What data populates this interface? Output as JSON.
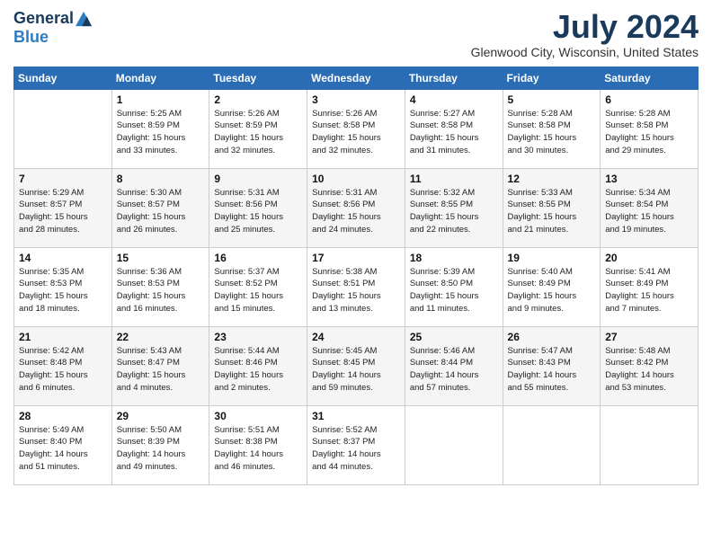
{
  "logo": {
    "text_general": "General",
    "text_blue": "Blue"
  },
  "title": "July 2024",
  "location": "Glenwood City, Wisconsin, United States",
  "days_of_week": [
    "Sunday",
    "Monday",
    "Tuesday",
    "Wednesday",
    "Thursday",
    "Friday",
    "Saturday"
  ],
  "weeks": [
    [
      {
        "day": "",
        "info": ""
      },
      {
        "day": "1",
        "info": "Sunrise: 5:25 AM\nSunset: 8:59 PM\nDaylight: 15 hours\nand 33 minutes."
      },
      {
        "day": "2",
        "info": "Sunrise: 5:26 AM\nSunset: 8:59 PM\nDaylight: 15 hours\nand 32 minutes."
      },
      {
        "day": "3",
        "info": "Sunrise: 5:26 AM\nSunset: 8:58 PM\nDaylight: 15 hours\nand 32 minutes."
      },
      {
        "day": "4",
        "info": "Sunrise: 5:27 AM\nSunset: 8:58 PM\nDaylight: 15 hours\nand 31 minutes."
      },
      {
        "day": "5",
        "info": "Sunrise: 5:28 AM\nSunset: 8:58 PM\nDaylight: 15 hours\nand 30 minutes."
      },
      {
        "day": "6",
        "info": "Sunrise: 5:28 AM\nSunset: 8:58 PM\nDaylight: 15 hours\nand 29 minutes."
      }
    ],
    [
      {
        "day": "7",
        "info": "Sunrise: 5:29 AM\nSunset: 8:57 PM\nDaylight: 15 hours\nand 28 minutes."
      },
      {
        "day": "8",
        "info": "Sunrise: 5:30 AM\nSunset: 8:57 PM\nDaylight: 15 hours\nand 26 minutes."
      },
      {
        "day": "9",
        "info": "Sunrise: 5:31 AM\nSunset: 8:56 PM\nDaylight: 15 hours\nand 25 minutes."
      },
      {
        "day": "10",
        "info": "Sunrise: 5:31 AM\nSunset: 8:56 PM\nDaylight: 15 hours\nand 24 minutes."
      },
      {
        "day": "11",
        "info": "Sunrise: 5:32 AM\nSunset: 8:55 PM\nDaylight: 15 hours\nand 22 minutes."
      },
      {
        "day": "12",
        "info": "Sunrise: 5:33 AM\nSunset: 8:55 PM\nDaylight: 15 hours\nand 21 minutes."
      },
      {
        "day": "13",
        "info": "Sunrise: 5:34 AM\nSunset: 8:54 PM\nDaylight: 15 hours\nand 19 minutes."
      }
    ],
    [
      {
        "day": "14",
        "info": "Sunrise: 5:35 AM\nSunset: 8:53 PM\nDaylight: 15 hours\nand 18 minutes."
      },
      {
        "day": "15",
        "info": "Sunrise: 5:36 AM\nSunset: 8:53 PM\nDaylight: 15 hours\nand 16 minutes."
      },
      {
        "day": "16",
        "info": "Sunrise: 5:37 AM\nSunset: 8:52 PM\nDaylight: 15 hours\nand 15 minutes."
      },
      {
        "day": "17",
        "info": "Sunrise: 5:38 AM\nSunset: 8:51 PM\nDaylight: 15 hours\nand 13 minutes."
      },
      {
        "day": "18",
        "info": "Sunrise: 5:39 AM\nSunset: 8:50 PM\nDaylight: 15 hours\nand 11 minutes."
      },
      {
        "day": "19",
        "info": "Sunrise: 5:40 AM\nSunset: 8:49 PM\nDaylight: 15 hours\nand 9 minutes."
      },
      {
        "day": "20",
        "info": "Sunrise: 5:41 AM\nSunset: 8:49 PM\nDaylight: 15 hours\nand 7 minutes."
      }
    ],
    [
      {
        "day": "21",
        "info": "Sunrise: 5:42 AM\nSunset: 8:48 PM\nDaylight: 15 hours\nand 6 minutes."
      },
      {
        "day": "22",
        "info": "Sunrise: 5:43 AM\nSunset: 8:47 PM\nDaylight: 15 hours\nand 4 minutes."
      },
      {
        "day": "23",
        "info": "Sunrise: 5:44 AM\nSunset: 8:46 PM\nDaylight: 15 hours\nand 2 minutes."
      },
      {
        "day": "24",
        "info": "Sunrise: 5:45 AM\nSunset: 8:45 PM\nDaylight: 14 hours\nand 59 minutes."
      },
      {
        "day": "25",
        "info": "Sunrise: 5:46 AM\nSunset: 8:44 PM\nDaylight: 14 hours\nand 57 minutes."
      },
      {
        "day": "26",
        "info": "Sunrise: 5:47 AM\nSunset: 8:43 PM\nDaylight: 14 hours\nand 55 minutes."
      },
      {
        "day": "27",
        "info": "Sunrise: 5:48 AM\nSunset: 8:42 PM\nDaylight: 14 hours\nand 53 minutes."
      }
    ],
    [
      {
        "day": "28",
        "info": "Sunrise: 5:49 AM\nSunset: 8:40 PM\nDaylight: 14 hours\nand 51 minutes."
      },
      {
        "day": "29",
        "info": "Sunrise: 5:50 AM\nSunset: 8:39 PM\nDaylight: 14 hours\nand 49 minutes."
      },
      {
        "day": "30",
        "info": "Sunrise: 5:51 AM\nSunset: 8:38 PM\nDaylight: 14 hours\nand 46 minutes."
      },
      {
        "day": "31",
        "info": "Sunrise: 5:52 AM\nSunset: 8:37 PM\nDaylight: 14 hours\nand 44 minutes."
      },
      {
        "day": "",
        "info": ""
      },
      {
        "day": "",
        "info": ""
      },
      {
        "day": "",
        "info": ""
      }
    ]
  ]
}
